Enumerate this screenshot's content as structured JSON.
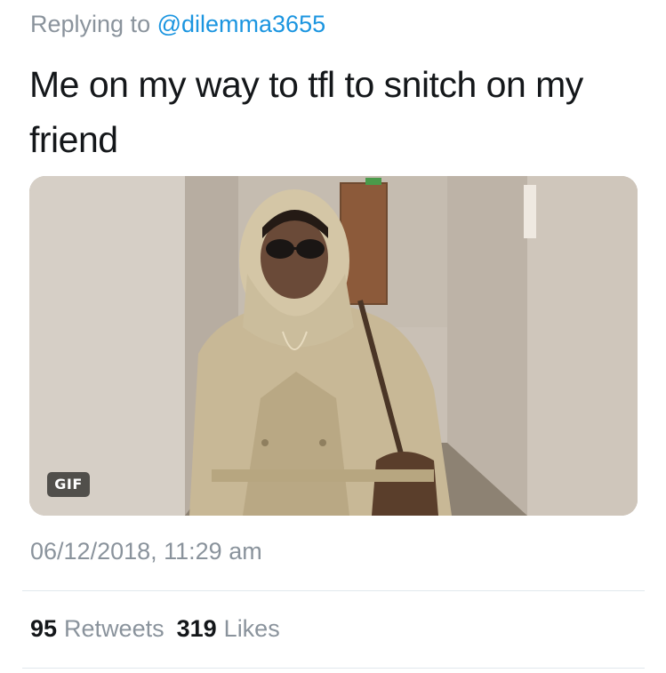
{
  "tweet": {
    "reply_prefix": "Replying to ",
    "reply_handle": "@dilemma3655",
    "text": "Me on my way to tfl to snitch on my friend",
    "media": {
      "badge": "GIF",
      "icon": "gif-media-image"
    },
    "timestamp": "06/12/2018, 11:29 am",
    "stats": {
      "retweets_count": "95",
      "retweets_label": "Retweets",
      "likes_count": "319",
      "likes_label": "Likes"
    }
  },
  "colors": {
    "link": "#1b95e0",
    "secondary_text": "#8a939c",
    "primary_text": "#14171a",
    "divider": "#e1e8ed"
  }
}
